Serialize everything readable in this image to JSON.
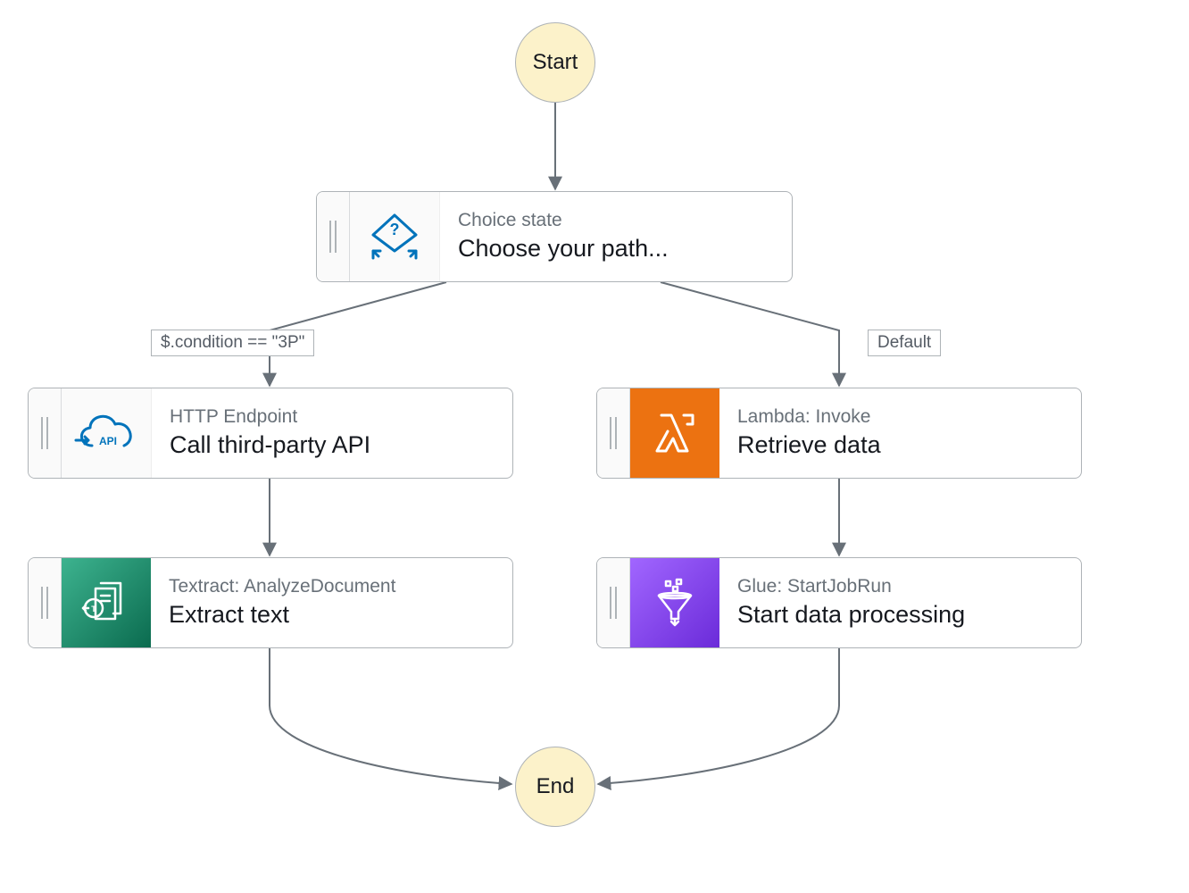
{
  "terminals": {
    "start": "Start",
    "end": "End"
  },
  "nodes": {
    "choice": {
      "type": "Choice state",
      "name": "Choose your path..."
    },
    "http": {
      "type": "HTTP Endpoint",
      "name": "Call third-party API"
    },
    "lambda": {
      "type": "Lambda: Invoke",
      "name": "Retrieve data"
    },
    "textract": {
      "type": "Textract: AnalyzeDocument",
      "name": "Extract text"
    },
    "glue": {
      "type": "Glue: StartJobRun",
      "name": "Start data processing"
    }
  },
  "edge_labels": {
    "left": "$.condition == \"3P\"",
    "right": "Default"
  },
  "colors": {
    "node_border": "#aeb3b7",
    "terminal_fill": "#fcf2ca",
    "choice_icon": "#0073bb",
    "http_icon_stroke": "#0073bb",
    "lambda_bg": "#ec7211",
    "textract_bg_start": "#3db38f",
    "textract_bg_end": "#0b6b4f",
    "glue_bg_start": "#a166ff",
    "glue_bg_end": "#6b2bd9",
    "arrow": "#687078"
  }
}
